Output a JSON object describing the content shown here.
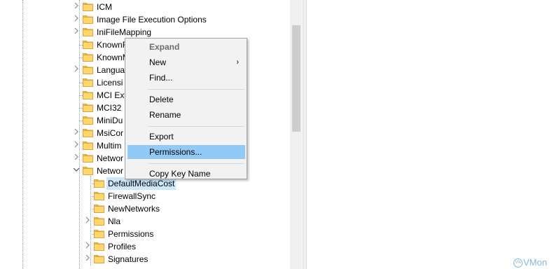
{
  "tree": {
    "items": [
      {
        "label": "ICM",
        "has_children": true,
        "expanded": false,
        "level": 0
      },
      {
        "label": "Image File Execution Options",
        "has_children": true,
        "expanded": false,
        "level": 0
      },
      {
        "label": "IniFileMapping",
        "has_children": true,
        "expanded": false,
        "level": 0
      },
      {
        "label": "KnownF",
        "has_children": false,
        "expanded": false,
        "level": 0
      },
      {
        "label": "KnownM",
        "has_children": false,
        "expanded": false,
        "level": 0
      },
      {
        "label": "Langua",
        "has_children": true,
        "expanded": false,
        "level": 0
      },
      {
        "label": "Licensi",
        "has_children": false,
        "expanded": false,
        "level": 0
      },
      {
        "label": "MCI Ext",
        "has_children": false,
        "expanded": false,
        "level": 0
      },
      {
        "label": "MCI32",
        "has_children": false,
        "expanded": false,
        "level": 0
      },
      {
        "label": "MiniDu",
        "has_children": false,
        "expanded": false,
        "level": 0
      },
      {
        "label": "MsiCor",
        "has_children": true,
        "expanded": false,
        "level": 0
      },
      {
        "label": "Multim",
        "has_children": true,
        "expanded": false,
        "level": 0
      },
      {
        "label": "Networ",
        "has_children": true,
        "expanded": false,
        "level": 0
      },
      {
        "label": "Networ",
        "has_children": true,
        "expanded": true,
        "level": 0
      },
      {
        "label": "DefaultMediaCost",
        "has_children": false,
        "expanded": false,
        "level": 1,
        "selected": true
      },
      {
        "label": "FirewallSync",
        "has_children": false,
        "expanded": false,
        "level": 1
      },
      {
        "label": "NewNetworks",
        "has_children": false,
        "expanded": false,
        "level": 1
      },
      {
        "label": "Nla",
        "has_children": true,
        "expanded": false,
        "level": 1
      },
      {
        "label": "Permissions",
        "has_children": false,
        "expanded": false,
        "level": 1
      },
      {
        "label": "Profiles",
        "has_children": true,
        "expanded": false,
        "level": 1
      },
      {
        "label": "Signatures",
        "has_children": true,
        "expanded": false,
        "level": 1
      }
    ]
  },
  "context_menu": {
    "items": [
      {
        "label": "Expand",
        "bold": true,
        "submenu": false,
        "highlighted": false
      },
      {
        "label": "New",
        "bold": false,
        "submenu": true,
        "highlighted": false
      },
      {
        "label": "Find...",
        "bold": false,
        "submenu": false,
        "highlighted": false
      },
      {
        "separator": true
      },
      {
        "label": "Delete",
        "bold": false,
        "submenu": false,
        "highlighted": false
      },
      {
        "label": "Rename",
        "bold": false,
        "submenu": false,
        "highlighted": false
      },
      {
        "separator": true
      },
      {
        "label": "Export",
        "bold": false,
        "submenu": false,
        "highlighted": false
      },
      {
        "label": "Permissions...",
        "bold": false,
        "submenu": false,
        "highlighted": true
      },
      {
        "separator": true
      },
      {
        "label": "Copy Key Name",
        "bold": false,
        "submenu": false,
        "highlighted": false
      }
    ],
    "submenu_arrow": "›"
  },
  "watermark": {
    "badge": "VN",
    "text": "VMon"
  },
  "colors": {
    "folder_fill": "#ffd76e",
    "folder_tab": "#f5c04a",
    "selection": "#cce8ff",
    "menu_highlight": "#91c9f7"
  },
  "icons": {
    "collapsed": "chevron-right-icon",
    "expanded": "chevron-down-icon",
    "folder": "folder-icon"
  }
}
